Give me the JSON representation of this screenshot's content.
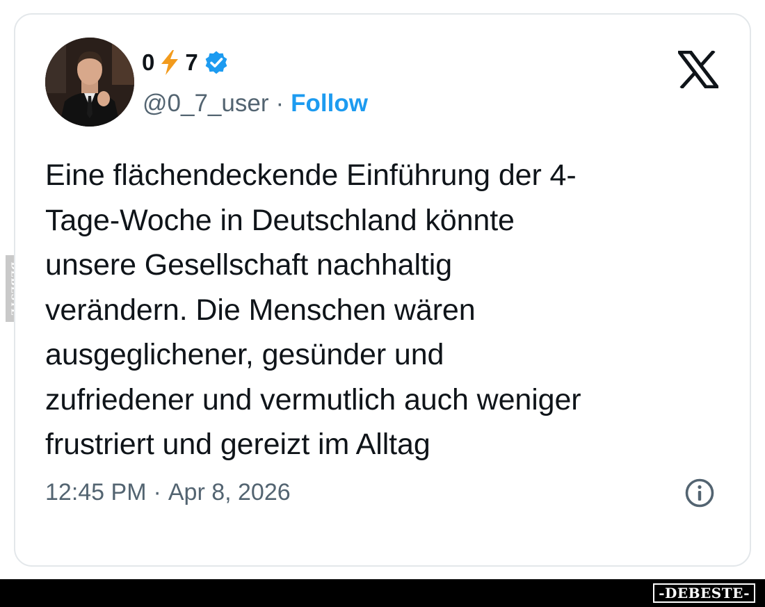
{
  "tweet": {
    "display_name_start": "0",
    "display_name_end": "7",
    "handle": "@0_7_user",
    "separator": "·",
    "follow_label": "Follow",
    "text": "Eine flächendeckende Einführung der 4-\nTage-Woche in Deutschland könnte\nunsere Gesellschaft nachhaltig\nverändern. Die Menschen wären\nausgeglichener, gesünder und\nzufriedener und vermutlich auch weniger\nfrustriert und gereizt im Alltag",
    "time": "12:45 PM",
    "date": "Apr 8, 2026"
  },
  "icons": {
    "name_emoji": "lightning-bolt-icon",
    "verified": "verified-badge-icon",
    "platform": "x-logo-icon",
    "info": "info-icon"
  },
  "watermark": {
    "side_text": "DEBESTE",
    "badge_text": "-DEBESTE-"
  },
  "colors": {
    "accent": "#1d9bf0",
    "text_primary": "#0f1419",
    "text_secondary": "#536471",
    "bolt": "#f29b1d"
  }
}
